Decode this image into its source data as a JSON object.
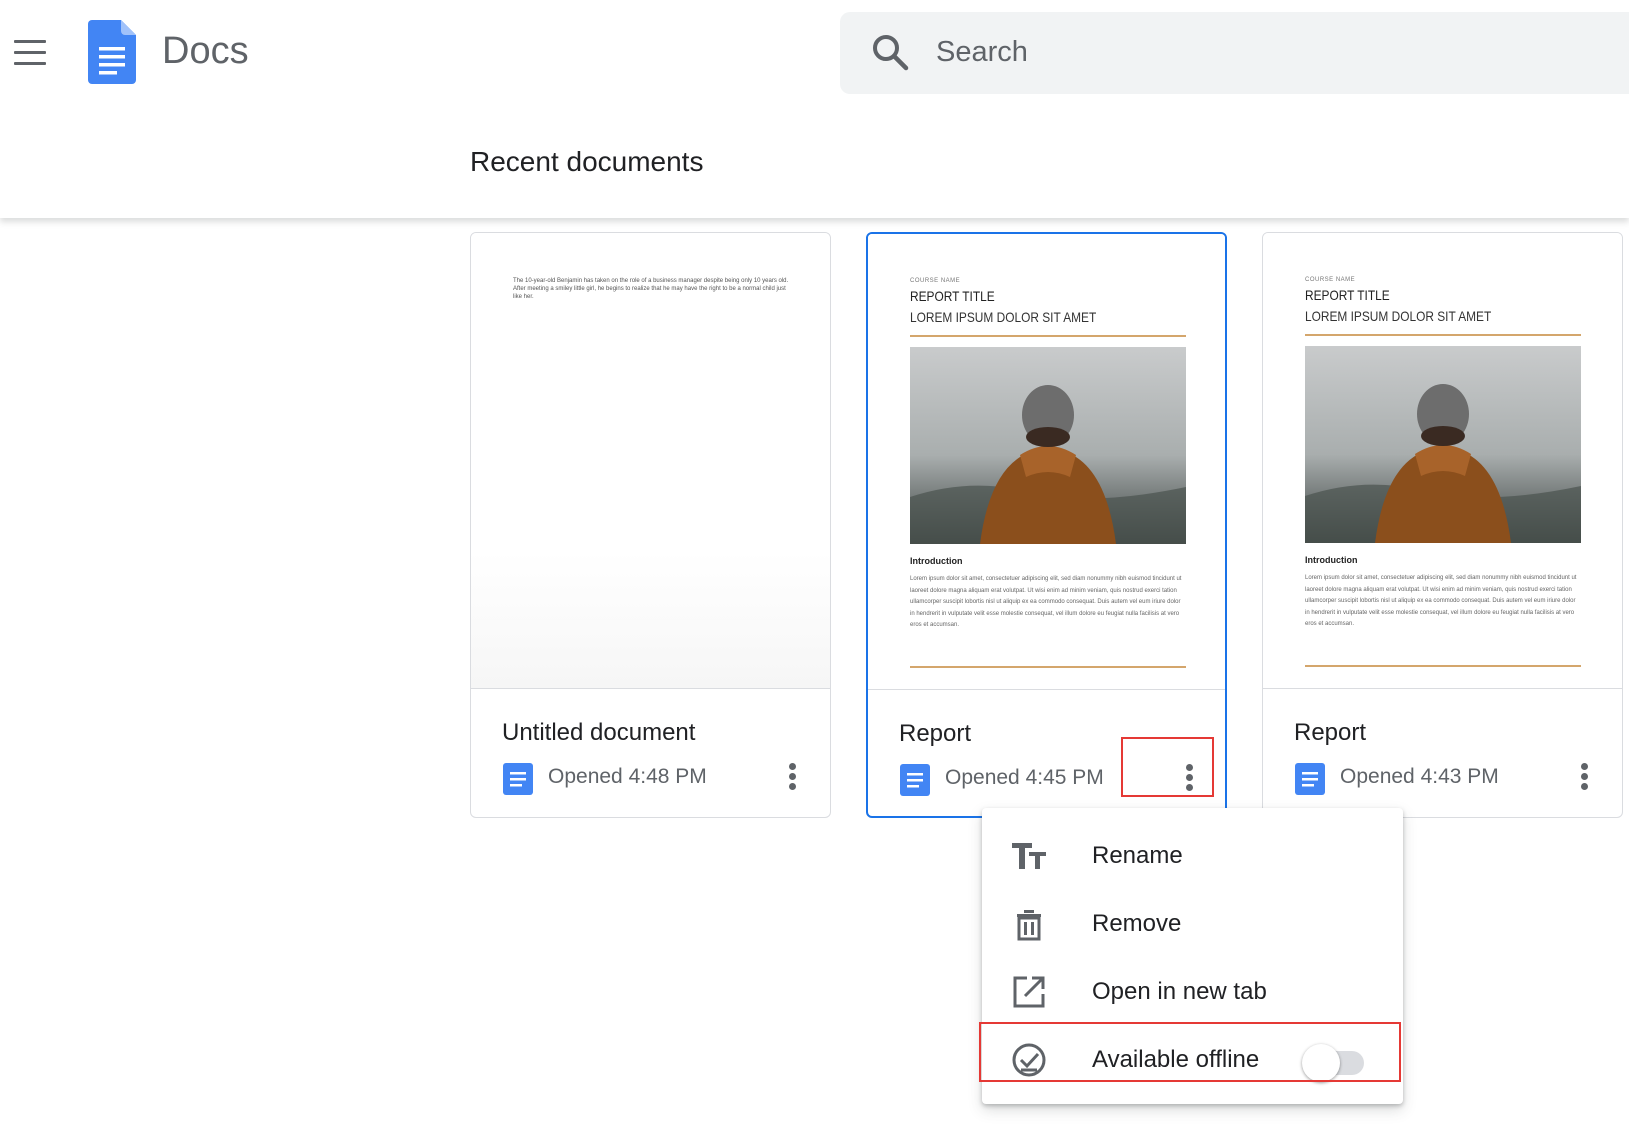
{
  "header": {
    "app_name": "Docs",
    "search_placeholder": "Search"
  },
  "section_title": "Recent documents",
  "documents": [
    {
      "title": "Untitled document",
      "opened": "Opened 4:48 PM",
      "preview_text": "The 10-year-old Benjamin has taken on the role of a business manager despite being only 10 years old. After meeting a smiley little girl, he begins to realize that he may have the right to be a normal child just like her."
    },
    {
      "title": "Report",
      "opened": "Opened 4:45 PM",
      "preview": {
        "course": "COURSE NAME",
        "title": "REPORT TITLE",
        "subtitle": "LOREM IPSUM DOLOR SIT AMET",
        "heading": "Introduction",
        "body": "Lorem ipsum dolor sit amet, consectetuer adipiscing elit, sed diam nonummy nibh euismod tincidunt ut laoreet dolore magna aliquam erat volutpat. Ut wisi enim ad minim veniam, quis nostrud exerci tation ullamcorper suscipit lobortis nisl ut aliquip ex ea commodo consequat. Duis autem vel eum iriure dolor in hendrerit in vulputate velit esse molestie consequat, vel illum dolore eu feugiat nulla facilisis at vero eros et accumsan."
      }
    },
    {
      "title": "Report",
      "opened": "Opened 4:43 PM",
      "preview": {
        "course": "COURSE NAME",
        "title": "REPORT TITLE",
        "subtitle": "LOREM IPSUM DOLOR SIT AMET",
        "heading": "Introduction",
        "body": "Lorem ipsum dolor sit amet, consectetuer adipiscing elit, sed diam nonummy nibh euismod tincidunt ut laoreet dolore magna aliquam erat volutpat. Ut wisi enim ad minim veniam, quis nostrud exerci tation ullamcorper suscipit lobortis nisl ut aliquip ex ea commodo consequat. Duis autem vel eum iriure dolor in hendrerit in vulputate velit esse molestie consequat, vel illum dolore eu feugiat nulla facilisis at vero eros et accumsan."
      }
    }
  ],
  "context_menu": {
    "items": [
      {
        "label": "Rename",
        "icon": "text-format-icon"
      },
      {
        "label": "Remove",
        "icon": "trash-icon"
      },
      {
        "label": "Open in new tab",
        "icon": "open-in-new-icon"
      },
      {
        "label": "Available offline",
        "icon": "offline-check-icon",
        "toggle_on": false
      }
    ]
  },
  "colors": {
    "brand_blue": "#4285f4",
    "selected_border": "#1a73e8",
    "highlight_red": "#e53935",
    "report_accent": "#d4a66c"
  }
}
